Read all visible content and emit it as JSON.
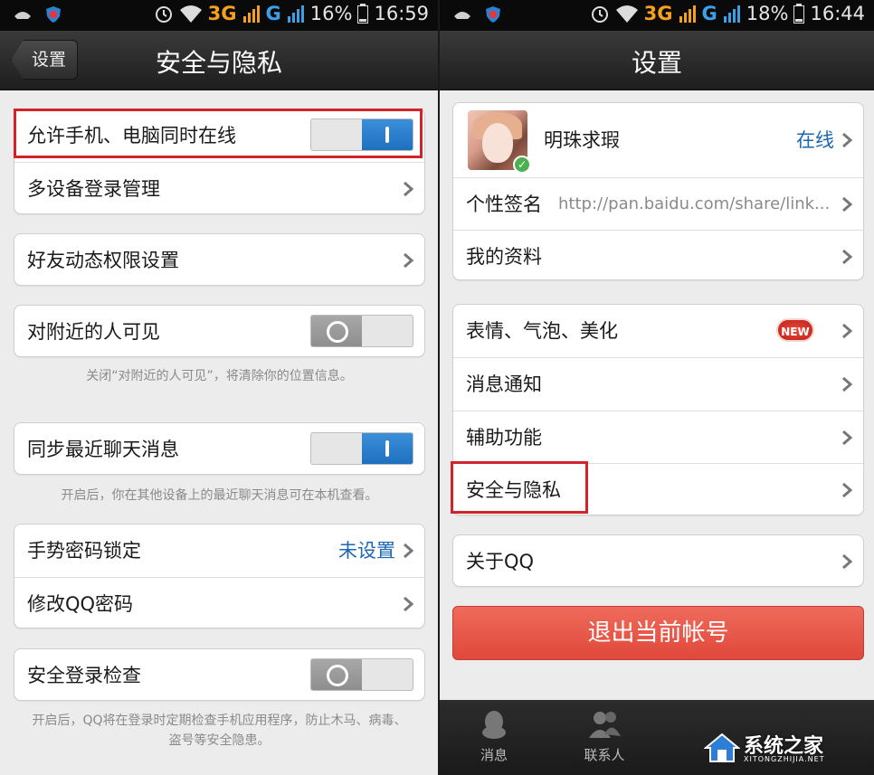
{
  "left": {
    "status": {
      "net1": "3G",
      "net2": "G",
      "battery": "16%",
      "time": "16:59"
    },
    "header": {
      "back_label": "设置",
      "title": "安全与隐私"
    },
    "rows": {
      "allow_online": "允许手机、电脑同时在线",
      "multi_device": "多设备登录管理",
      "friend_feed": "好友动态权限设置",
      "nearby_visible": "对附近的人可见",
      "sync_chat": "同步最近聊天消息",
      "gesture_lock": "手势密码锁定",
      "gesture_lock_value": "未设置",
      "change_password": "修改QQ密码",
      "safe_login_check": "安全登录检查"
    },
    "notes": {
      "nearby": "关闭“对附近的人可见”，将清除你的位置信息。",
      "sync": "开启后，你在其他设备上的最近聊天消息可在本机查看。",
      "safe_login": "开启后，QQ将在登录时定期检查手机应用程序，防止木马、病毒、盗号等安全隐患。"
    },
    "toggles": {
      "allow_online": "on",
      "nearby_visible": "off",
      "sync_chat": "on",
      "safe_login_check": "off"
    }
  },
  "right": {
    "status": {
      "net1": "3G",
      "net2": "G",
      "battery": "18%",
      "time": "16:44"
    },
    "header": {
      "title": "设置"
    },
    "profile": {
      "name": "明珠求瑕",
      "status": "在线"
    },
    "rows": {
      "signature_label": "个性签名",
      "signature_value": "http://pan.baidu.com/share/link...",
      "my_profile": "我的资料",
      "emoji": "表情、气泡、美化",
      "new_badge": "NEW",
      "notifications": "消息通知",
      "accessibility": "辅助功能",
      "security_privacy": "安全与隐私",
      "about": "关于QQ"
    },
    "logout_label": "退出当前帐号",
    "tabs": {
      "messages": "消息",
      "contacts": "联系人"
    }
  },
  "watermark": {
    "text": "系统之家",
    "sub": "XITONGZHIJIA.NET"
  },
  "colors": {
    "accent_blue": "#1c67b3",
    "highlight_red": "#d2232a",
    "logout_red": "#e55a4a"
  }
}
